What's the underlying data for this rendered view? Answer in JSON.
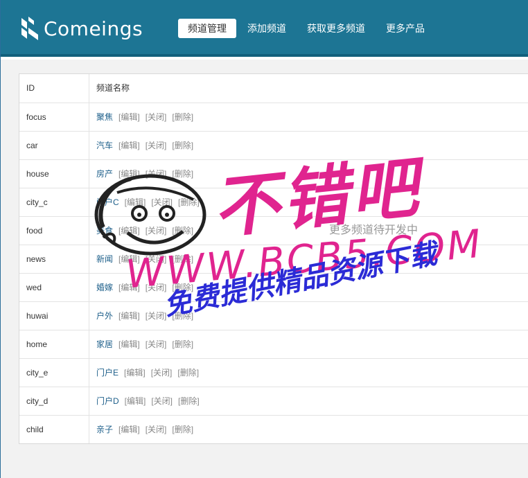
{
  "app": {
    "logo_text": "Comeings"
  },
  "nav": [
    {
      "label": "频道管理",
      "active": true
    },
    {
      "label": "添加频道",
      "active": false
    },
    {
      "label": "获取更多频道",
      "active": false
    },
    {
      "label": "更多产品",
      "active": false
    }
  ],
  "table": {
    "headers": {
      "id": "ID",
      "name": "频道名称"
    },
    "actions": {
      "edit": "[编辑]",
      "close": "[关闭]",
      "delete": "[删除]"
    },
    "rows": [
      {
        "id": "focus",
        "name": "聚焦"
      },
      {
        "id": "car",
        "name": "汽车"
      },
      {
        "id": "house",
        "name": "房产"
      },
      {
        "id": "city_c",
        "name": "门户C"
      },
      {
        "id": "food",
        "name": "美食"
      },
      {
        "id": "news",
        "name": "新闻"
      },
      {
        "id": "wed",
        "name": "婚嫁"
      },
      {
        "id": "huwai",
        "name": "户外"
      },
      {
        "id": "home",
        "name": "家居"
      },
      {
        "id": "city_e",
        "name": "门户E"
      },
      {
        "id": "city_d",
        "name": "门户D"
      },
      {
        "id": "child",
        "name": "亲子"
      }
    ]
  },
  "notice": "更多频道待开发中",
  "watermark": {
    "title": "不错吧",
    "url": "WWW.BCB5.COM",
    "tagline": "免费提供精品资源下载",
    "colors": {
      "pink": "#e0248f",
      "blue": "#2b2bd6"
    }
  },
  "colors": {
    "header": "#1d7594",
    "link": "#1d5f8a"
  }
}
